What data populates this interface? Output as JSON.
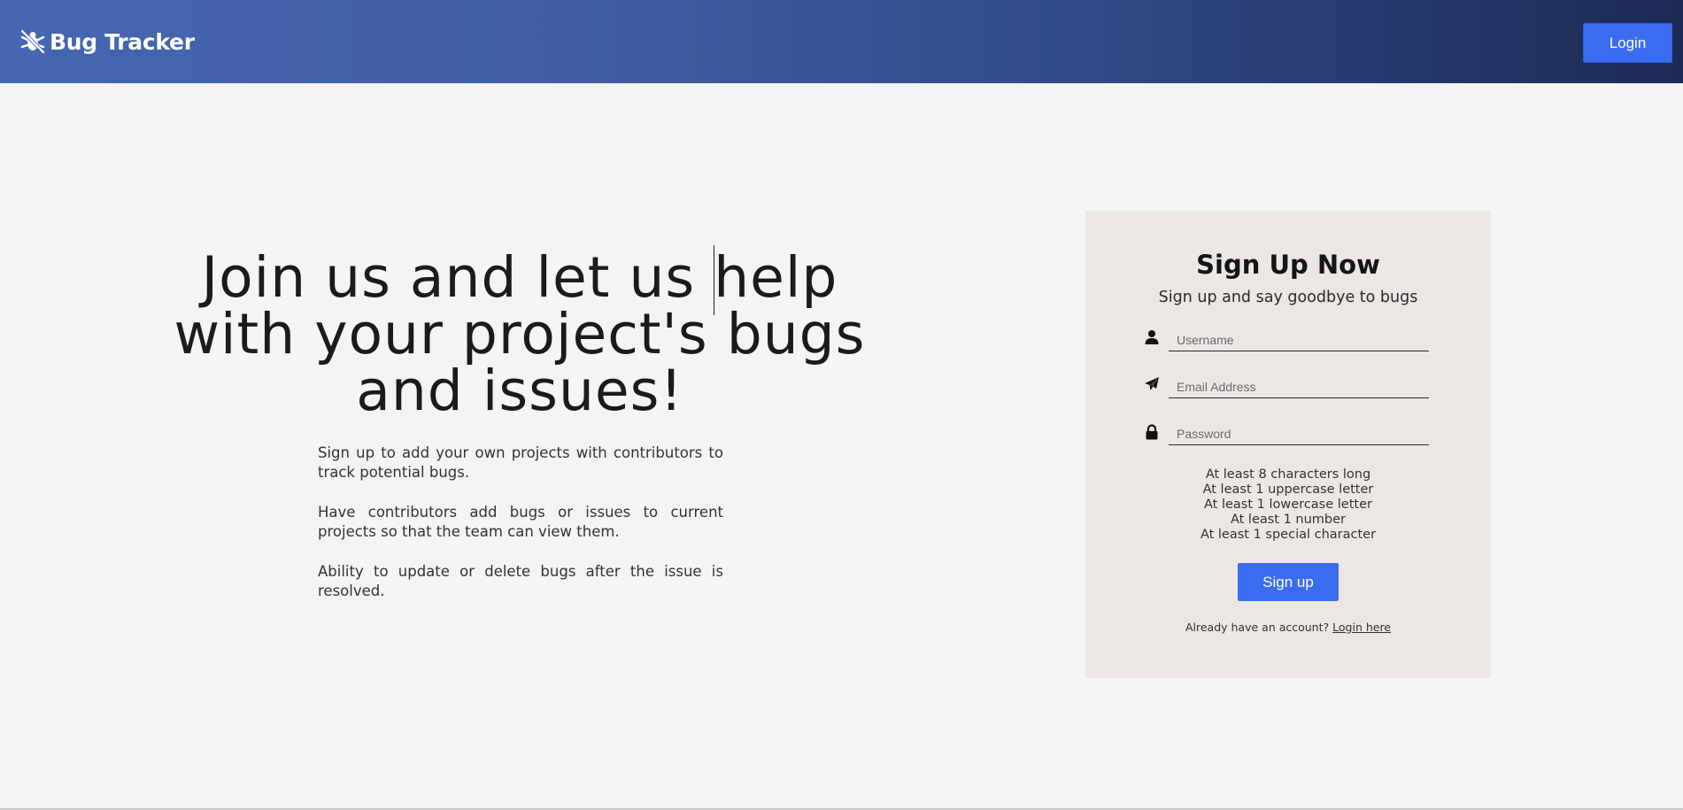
{
  "header": {
    "brand": "Bug Tracker",
    "login_label": "Login"
  },
  "hero": {
    "title": "Join us and let us help with your project's bugs and issues!",
    "features": [
      "Sign up to add your own projects with contributors to track potential bugs.",
      "Have contributors add bugs or issues to current projects so that the team can view them.",
      "Ability to update or delete bugs after the issue is resolved."
    ]
  },
  "signup": {
    "title": "Sign Up Now",
    "subtitle": "Sign up and say goodbye to bugs",
    "username_placeholder": "Username",
    "email_placeholder": "Email Address",
    "password_placeholder": "Password",
    "requirements": [
      "At least 8 characters long",
      "At least 1 uppercase letter",
      "At least 1 lowercase letter",
      "At least 1 number",
      "At least 1 special character"
    ],
    "button_label": "Sign up",
    "login_prompt": "Already have an account?",
    "login_link": "Login here"
  },
  "icons": {
    "brand": "bug-off-icon",
    "username": "user-icon",
    "email": "paper-plane-icon",
    "password": "lock-icon"
  },
  "colors": {
    "header_gradient_start": "#4766b2",
    "header_gradient_end": "#1c2b54",
    "accent": "#3b6cf0",
    "page_background": "#f4f4f4",
    "card_background": "#ebe7e5"
  }
}
